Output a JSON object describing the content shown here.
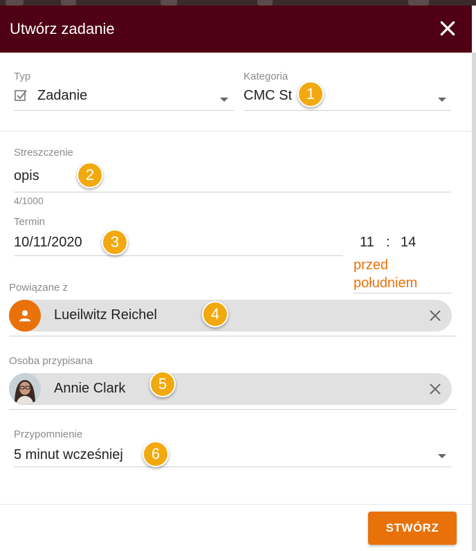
{
  "dialog": {
    "title": "Utwórz zadanie",
    "create_button": "STWÓRZ"
  },
  "type_field": {
    "label": "Typ",
    "value": "Zadanie",
    "icon": "checkbox-icon"
  },
  "category_field": {
    "label": "Kategoria",
    "value": "CMC St"
  },
  "summary_field": {
    "label": "Streszczenie",
    "value": "opis",
    "counter": "4/1000"
  },
  "due_field": {
    "label": "Termin",
    "date": "10/11/2020",
    "hour": "11",
    "separator": ":",
    "minute": "14",
    "period": "przed południem"
  },
  "related_field": {
    "label": "Powiązane z",
    "value": "Lueilwitz Reichel",
    "icon": "person-icon"
  },
  "assignee_field": {
    "label": "Osoba przypisana",
    "value": "Annie Clark"
  },
  "reminder_field": {
    "label": "Przypomnienie",
    "value": "5 minut wcześniej"
  },
  "badges": [
    "1",
    "2",
    "3",
    "4",
    "5",
    "6"
  ],
  "colors": {
    "header": "#4f0013",
    "accent": "#e8710a",
    "badge": "#f2a90f",
    "chip": "#e1e1e1"
  }
}
